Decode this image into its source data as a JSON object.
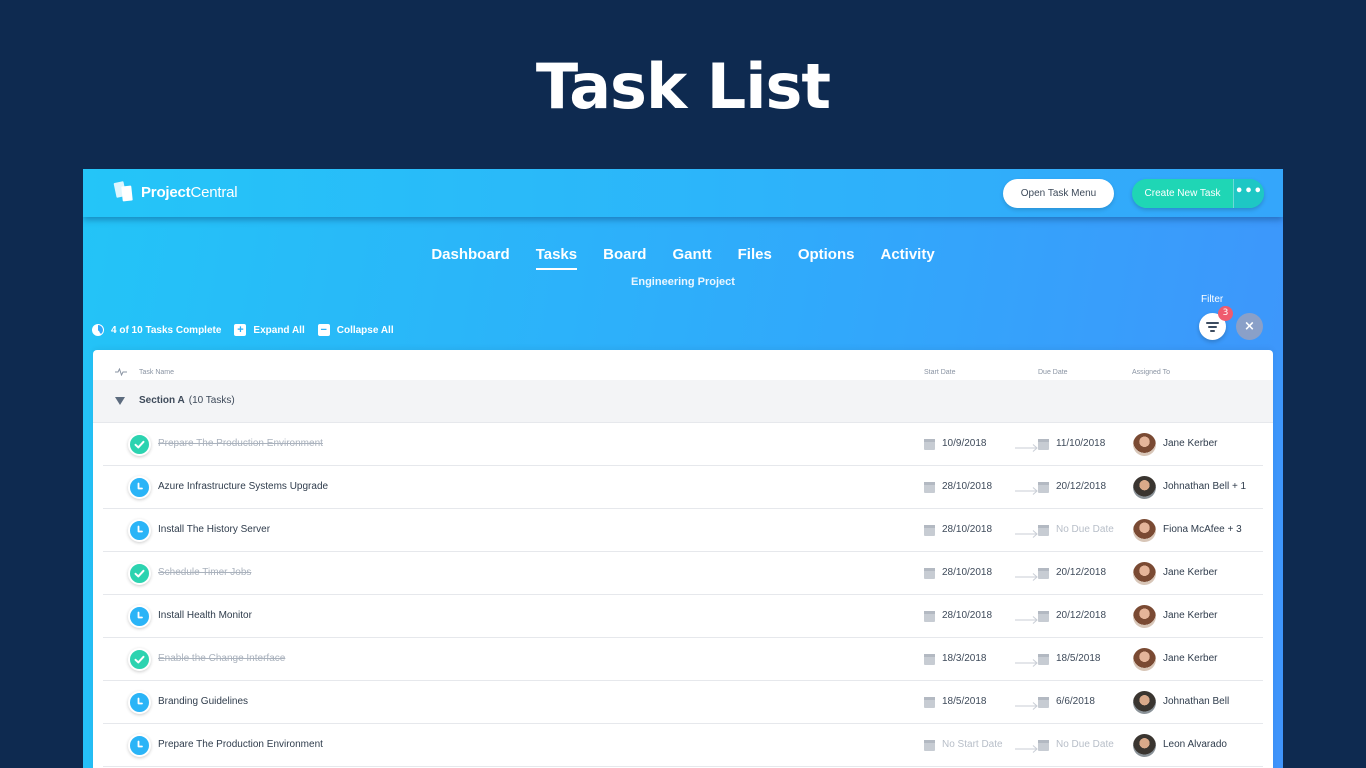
{
  "page_title": "Task List",
  "app": {
    "logo": {
      "bold": "Project",
      "regular": "Central"
    },
    "open_task_menu_label": "Open Task Menu",
    "create_task_label": "Create New Task",
    "more_label": "•••",
    "nav": [
      {
        "label": "Dashboard",
        "active": false
      },
      {
        "label": "Tasks",
        "active": true
      },
      {
        "label": "Board",
        "active": false
      },
      {
        "label": "Gantt",
        "active": false
      },
      {
        "label": "Files",
        "active": false
      },
      {
        "label": "Options",
        "active": false
      },
      {
        "label": "Activity",
        "active": false
      }
    ],
    "project_name": "Engineering Project",
    "toolbar": {
      "progress_label": "4 of 10 Tasks Complete",
      "expand_label": "Expand All",
      "collapse_label": "Collapse All"
    },
    "filter": {
      "label": "Filter",
      "badge": "3",
      "clear_icon": "×"
    },
    "columns": {
      "task_name": "Task Name",
      "start_date": "Start Date",
      "due_date": "Due Date",
      "assigned_to": "Assigned To"
    },
    "section": {
      "name": "Section A",
      "count": "(10 Tasks)"
    },
    "tasks": [
      {
        "name": "Prepare The Production Environment",
        "done": true,
        "start": "10/9/2018",
        "due": "11/10/2018",
        "assignee": "Jane Kerber",
        "avatar": "f"
      },
      {
        "name": "Azure Infrastructure Systems Upgrade",
        "done": false,
        "start": "28/10/2018",
        "due": "20/12/2018",
        "assignee": "Johnathan Bell + 1",
        "avatar": "m"
      },
      {
        "name": "Install The History Server",
        "done": false,
        "start": "28/10/2018",
        "due": "No Due Date",
        "assignee": "Fiona McAfee + 3",
        "avatar": "f"
      },
      {
        "name": "Schedule Timer Jobs",
        "done": true,
        "start": "28/10/2018",
        "due": "20/12/2018",
        "assignee": "Jane Kerber",
        "avatar": "f"
      },
      {
        "name": "Install Health Monitor",
        "done": false,
        "start": "28/10/2018",
        "due": "20/12/2018",
        "assignee": "Jane Kerber",
        "avatar": "f"
      },
      {
        "name": "Enable the Change Interface",
        "done": true,
        "start": "18/3/2018",
        "due": "18/5/2018",
        "assignee": "Jane Kerber",
        "avatar": "f"
      },
      {
        "name": "Branding Guidelines",
        "done": false,
        "start": "18/5/2018",
        "due": "6/6/2018",
        "assignee": "Johnathan Bell",
        "avatar": "m"
      },
      {
        "name": "Prepare The Production Environment",
        "done": false,
        "start": "No Start Date",
        "due": "No Due Date",
        "assignee": "Leon Alvarado",
        "avatar": "m"
      }
    ],
    "colors": {
      "background": "#0e2a50",
      "header_gradient_start": "#23c4f7",
      "header_gradient_end": "#3f94fb",
      "create_button": "#1fd6b5",
      "done_status": "#2cd3b0",
      "todo_status": "#2ab4f7",
      "filter_badge": "#ef5b6e"
    }
  }
}
